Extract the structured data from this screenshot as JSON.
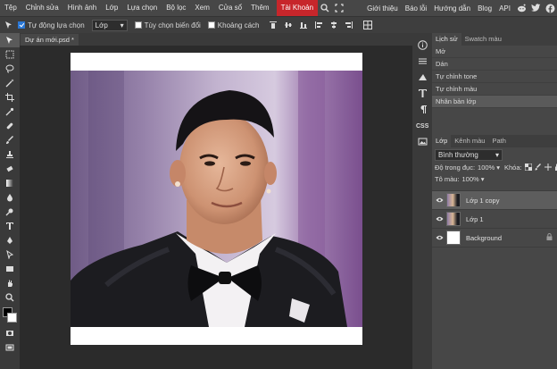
{
  "menu": {
    "items": [
      "Tệp",
      "Chỉnh sửa",
      "Hình ảnh",
      "Lớp",
      "Lựa chọn",
      "Bộ lọc",
      "Xem",
      "Cửa sổ",
      "Thêm"
    ],
    "account": "Tài Khoản",
    "right": [
      "Giới thiệu",
      "Báo lỗi",
      "Hướng dẫn",
      "Blog",
      "API"
    ]
  },
  "options": {
    "auto_select": "Tự động lựa chọn",
    "auto_select_checked": true,
    "target": "Lớp",
    "transform": "Tùy chọn biến đổi",
    "transform_checked": false,
    "distance": "Khoảng cách",
    "distance_checked": false
  },
  "document": {
    "tab": "Dự án mới.psd *"
  },
  "history": {
    "tabs": [
      "Lịch sử",
      "Swatch màu"
    ],
    "items": [
      "Mở",
      "Dán",
      "Tự chỉnh tone",
      "Tự chỉnh màu",
      "Nhân bản lớp"
    ],
    "selected": 4
  },
  "layers_panel": {
    "tabs": [
      "Lớp",
      "Kênh màu",
      "Path"
    ],
    "blend_mode": "Bình thường",
    "opacity_label": "Độ trong đục:",
    "opacity_value": "100%",
    "lock_label": "Khóa:",
    "fill_label": "Tô màu:",
    "fill_value": "100%",
    "layers": [
      {
        "name": "Lớp 1 copy",
        "selected": true
      },
      {
        "name": "Lớp 1",
        "selected": false
      },
      {
        "name": "Background",
        "selected": false,
        "locked": true
      }
    ]
  },
  "colors": {
    "accent": "#c7262b",
    "checkbox": "#2b78d6"
  }
}
